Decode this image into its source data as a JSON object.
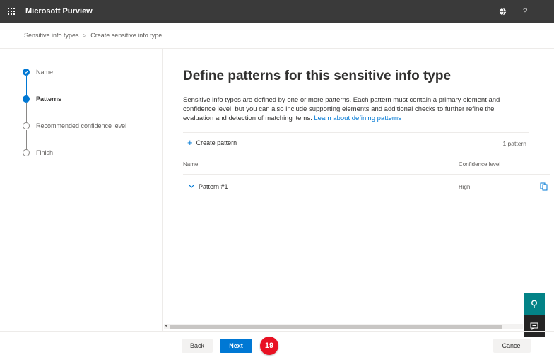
{
  "header": {
    "app_title": "Microsoft Purview"
  },
  "breadcrumb": {
    "items": [
      "Sensitive info types",
      "Create sensitive info type"
    ]
  },
  "steps": [
    {
      "label": "Name",
      "state": "done"
    },
    {
      "label": "Patterns",
      "state": "current"
    },
    {
      "label": "Recommended confidence level",
      "state": "todo"
    },
    {
      "label": "Finish",
      "state": "todo"
    }
  ],
  "main": {
    "title": "Define patterns for this sensitive info type",
    "description": "Sensitive info types are defined by one or more patterns. Each pattern must contain a primary element and confidence level, but you can also include supporting elements and additional checks to further refine the evaluation and detection of matching items.",
    "learn_link": "Learn about defining patterns",
    "create_label": "Create pattern",
    "count_label": "1 pattern",
    "columns": [
      "Name",
      "Confidence level"
    ],
    "rows": [
      {
        "name": "Pattern #1",
        "confidence": "High"
      }
    ]
  },
  "footer": {
    "back_label": "Back",
    "next_label": "Next",
    "cancel_label": "Cancel",
    "step_badge": "19"
  },
  "colors": {
    "accent": "#0078d4",
    "topbar": "#3a3a3a",
    "teal": "#038387",
    "badge": "#e81123"
  }
}
